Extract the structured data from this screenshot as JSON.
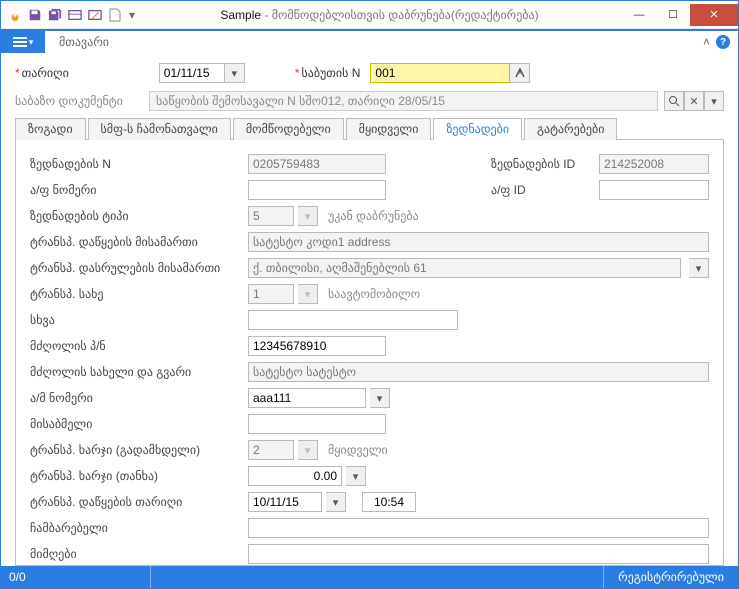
{
  "title": {
    "app": "Sample",
    "rest": " - მომწოდებლისთვის დაბრუნება(რედაქტირება)"
  },
  "ribbon": {
    "main_tab": "მთავარი"
  },
  "header": {
    "date_label": "თარიღი",
    "date_value": "01/11/15",
    "docnum_label": "საბუთის N",
    "docnum_value": "001",
    "basedoc_label": "საბაზო დოკუმენტი",
    "basedoc_value": "საწყობის შემოსავალი N სშო012, თარიღი  28/05/15"
  },
  "tabs": {
    "t1": "ზოგადი",
    "t2": "სმფ-ს ჩამონათვალი",
    "t3": "მომწოდებელი",
    "t4": "მყიდველი",
    "t5": "ზედნადები",
    "t6": "გატარებები"
  },
  "form": {
    "zn_n_label": "ზედნადების N",
    "zn_n_value": "0205759483",
    "zn_id_label": "ზედნადების ID",
    "zn_id_value": "214252008",
    "af_no_label": "ა/ფ ნომერი",
    "af_no_value": "",
    "af_id_label": "ა/ფ ID",
    "af_id_value": "",
    "zn_type_label": "ზედნადების ტიპი",
    "zn_type_value": "5",
    "zn_type_text": "უკან დაბრუნება",
    "trans_start_addr_label": "ტრანსპ. დაწყების მისამართი",
    "trans_start_addr_value": "სატესტო კოდი1 address",
    "trans_end_addr_label": "ტრანსპ. დასრულების მისამართი",
    "trans_end_addr_value": "ქ. თბილისი, აღმაშენებლის 61",
    "trans_type_label": "ტრანსპ. სახე",
    "trans_type_value": "1",
    "trans_type_text": "საავტომობილო",
    "other_label": "სხვა",
    "other_value": "",
    "driver_pn_label": "მძღოლის პ/ნ",
    "driver_pn_value": "12345678910",
    "driver_name_label": "მძღოლის სახელი და გვარი",
    "driver_name_value": "სატესტო სატესტო",
    "car_no_label": "ა/მ ნომერი",
    "car_no_value": "aaa111",
    "trailer_label": "მისაბმელი",
    "trailer_value": "",
    "cost_payer_label": "ტრანსპ. ხარჯი (გადამხდელი)",
    "cost_payer_value": "2",
    "cost_payer_text": "მყიდველი",
    "cost_amount_label": "ტრანსპ. ხარჯი (თანხა)",
    "cost_amount_value": "0.00",
    "start_date_label": "ტრანსპ. დაწყების თარიღი",
    "start_date_value": "10/11/15",
    "start_time_value": "10:54",
    "receiver_label": "ჩამბარებელი",
    "receiver_value": "",
    "acceptor_label": "მიმღები",
    "acceptor_value": ""
  },
  "status": {
    "counter": "0/0",
    "state": "რეგისტრირებული"
  }
}
